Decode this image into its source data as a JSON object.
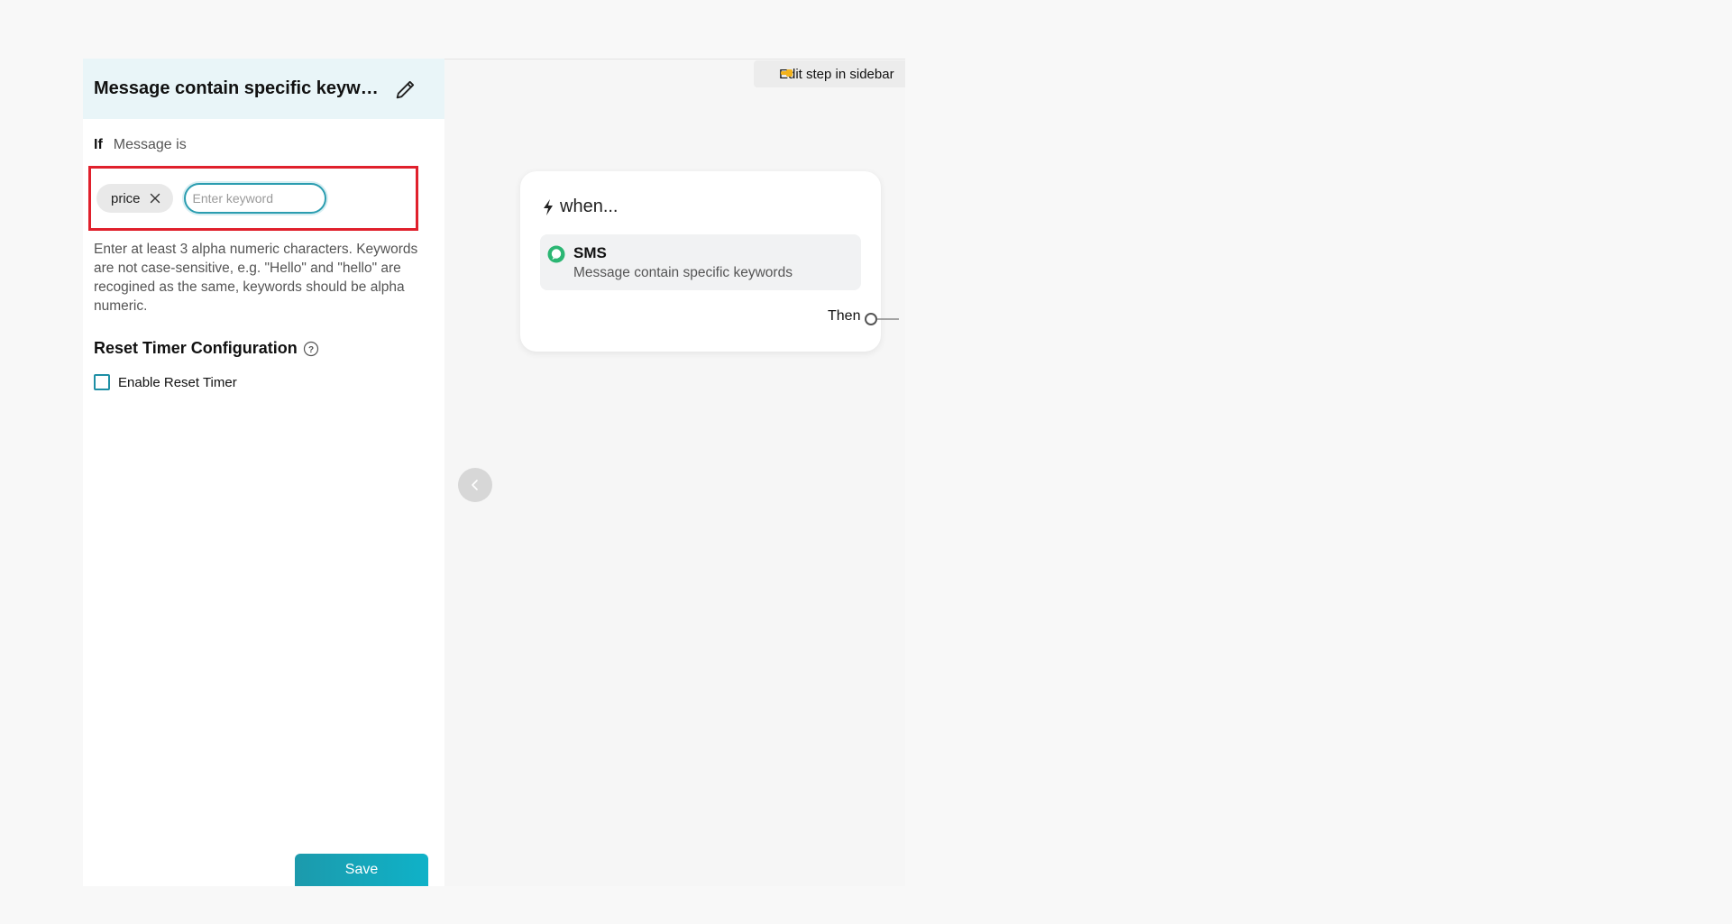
{
  "sidebar": {
    "title": "Message contain specific keywords",
    "condition": {
      "if_label": "If",
      "label": "Message is",
      "keywords": [
        "price"
      ],
      "input_placeholder": "Enter keyword"
    },
    "helper_text": "Enter at least 3 alpha numeric characters. Keywords are not case-sensitive, e.g. \"Hello\" and \"hello\" are recogined as the same, keywords should be alpha numeric.",
    "reset_timer": {
      "title": "Reset Timer Configuration",
      "checkbox_label": "Enable Reset Timer",
      "checked": false
    },
    "save_label": "Save"
  },
  "canvas": {
    "edit_hint": "Edit step in sidebar",
    "trigger": {
      "header": "when...",
      "step_title": "SMS",
      "step_subtitle": "Message contain specific keywords",
      "then_label": "Then"
    }
  },
  "colors": {
    "accent": "#1e9db1",
    "highlight_border": "#e0202c",
    "sms_green": "#2bb673",
    "header_bg": "#e9f5f8"
  },
  "icons": [
    "edit-pencil-icon",
    "close-icon",
    "help-circle-icon",
    "hand-pointing-icon",
    "chevron-left-icon",
    "bolt-icon",
    "sms-chat-icon"
  ]
}
